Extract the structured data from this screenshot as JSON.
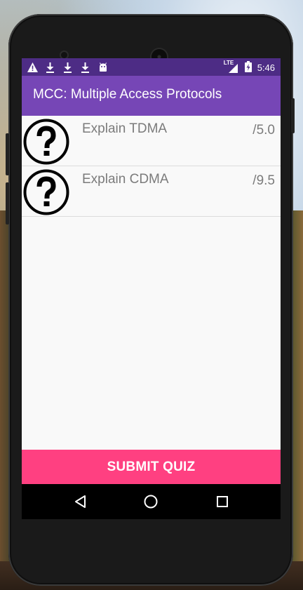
{
  "status_bar": {
    "left_icons": [
      "warning-icon",
      "download-icon",
      "download-icon",
      "download-icon",
      "android-icon"
    ],
    "network": "LTE",
    "time": "5:46"
  },
  "app_bar": {
    "title": "MCC: Multiple Access Protocols",
    "color": "#7646b6"
  },
  "questions": [
    {
      "icon": "question-mark-icon",
      "text": "Explain TDMA",
      "score": "/5.0"
    },
    {
      "icon": "question-mark-icon",
      "text": "Explain CDMA",
      "score": "/9.5"
    }
  ],
  "submit_button": {
    "label": "SUBMIT QUIZ",
    "color": "#ff4081"
  },
  "nav_bar": {
    "buttons": [
      "back-icon",
      "home-icon",
      "recents-icon"
    ]
  }
}
